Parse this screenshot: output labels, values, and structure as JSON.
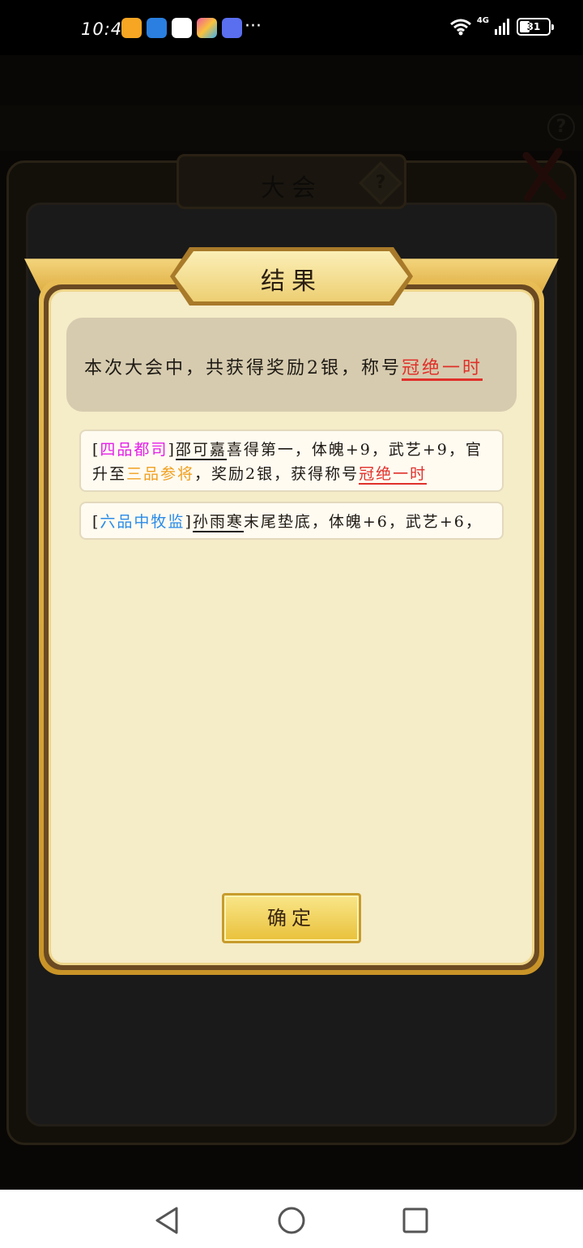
{
  "status_bar": {
    "time": "10:44",
    "more": "···",
    "network": "4G",
    "battery": "31"
  },
  "background": {
    "panel_title": "大会",
    "help_glyph": "?",
    "topbar_help_glyph": "?"
  },
  "result_dialog": {
    "title": "结果",
    "summary": {
      "prefix": "本次大会中，共获得奖励2银，称号",
      "title_name": "冠绝一时"
    },
    "entries": [
      {
        "rank_open": "[",
        "rank": "四品都司",
        "rank_close": "]",
        "name": "邵可嘉",
        "text1": "喜得第一，体魄+9，武艺+9，官升至",
        "new_rank": "三品参将",
        "text2": "，奖励2银，获得称号",
        "title_name": "冠绝一时"
      },
      {
        "rank_open": "[",
        "rank": "六品中牧监",
        "rank_close": "]",
        "name": "孙雨寒",
        "text1": "末尾垫底，体魄+6，武艺+6，"
      }
    ],
    "confirm_label": "确定"
  },
  "nav_bar": {
    "back_icon": "triangle-back-icon",
    "home_icon": "circle-home-icon",
    "recents_icon": "square-recents-icon"
  },
  "colors": {
    "accent_gold": "#e9c13a",
    "title_red": "#e0302a",
    "rank_pink": "#e21ee8",
    "rank_orange": "#f0a020",
    "rank_blue": "#2a8be8",
    "parchment": "#f5ecc8"
  }
}
